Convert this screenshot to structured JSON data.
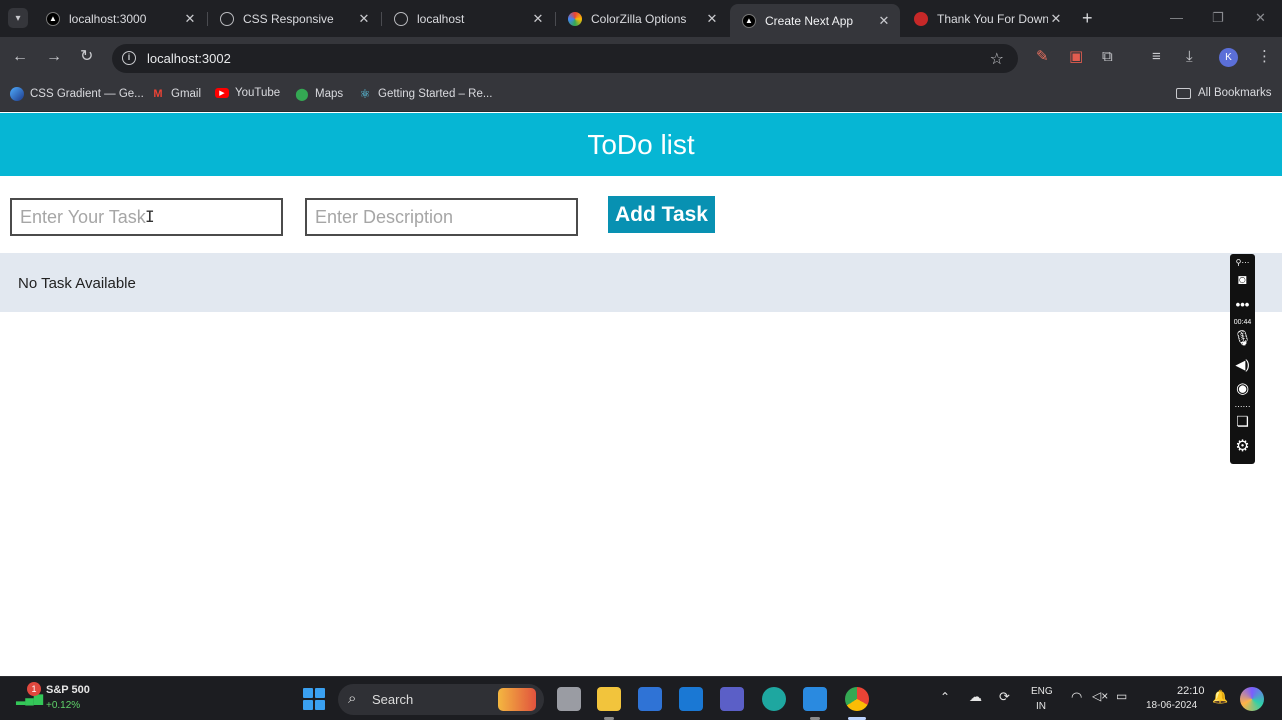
{
  "browser": {
    "tabs": [
      {
        "title": "localhost:3000",
        "favicon": "nextjs-icon",
        "active": false
      },
      {
        "title": "CSS Responsive",
        "favicon": "globe-icon",
        "active": false
      },
      {
        "title": "localhost",
        "favicon": "globe-icon",
        "active": false
      },
      {
        "title": "ColorZilla Options",
        "favicon": "colorzilla-icon",
        "active": false
      },
      {
        "title": "Create Next App",
        "favicon": "nextjs-icon",
        "active": true
      },
      {
        "title": "Thank You For Down",
        "favicon": "red-dot-icon",
        "active": false
      }
    ],
    "address": "localhost:3002",
    "bookmarks": [
      {
        "label": "CSS Gradient — Ge...",
        "icon": "css-gradient-icon"
      },
      {
        "label": "Gmail",
        "icon": "gmail-icon"
      },
      {
        "label": "YouTube",
        "icon": "youtube-icon"
      },
      {
        "label": "Maps",
        "icon": "maps-icon"
      },
      {
        "label": "Getting Started – Re...",
        "icon": "react-icon"
      }
    ],
    "all_bookmarks": "All Bookmarks",
    "profile_initial": "K"
  },
  "page": {
    "title": "ToDo list",
    "task_placeholder": "Enter Your Task",
    "description_placeholder": "Enter Description",
    "add_button": "Add Task",
    "empty_message": "No Task Available"
  },
  "recorder": {
    "timer": "00:44"
  },
  "taskbar": {
    "stock_name": "S&P 500",
    "stock_change": "+0.12%",
    "stock_badge": "1",
    "search_label": "Search",
    "lang_top": "ENG",
    "lang_bottom": "IN",
    "time": "22:10",
    "date": "18-06-2024"
  },
  "colors": {
    "header": "#06b6d4",
    "button": "#0891b2",
    "list_bg": "#e2e8f0"
  }
}
